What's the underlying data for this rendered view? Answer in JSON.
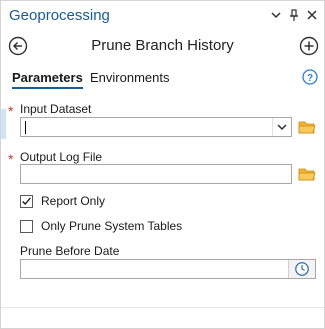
{
  "pane": {
    "title": "Geoprocessing"
  },
  "tool": {
    "title": "Prune Branch History"
  },
  "tabs": [
    {
      "label": "Parameters",
      "active": true
    },
    {
      "label": "Environments",
      "active": false
    }
  ],
  "params": {
    "input_dataset": {
      "label": "Input Dataset",
      "required": true,
      "value": ""
    },
    "output_log": {
      "label": "Output Log File",
      "required": true,
      "value": ""
    },
    "report_only": {
      "label": "Report Only",
      "checked": true
    },
    "system_tables": {
      "label": "Only Prune System Tables",
      "checked": false
    },
    "prune_date": {
      "label": "Prune Before Date",
      "value": ""
    }
  },
  "icons": {
    "options": "chevron-down-icon",
    "pin": "pin-icon",
    "close": "close-icon",
    "back": "back-arrow-icon",
    "add": "add-icon",
    "help": "help-icon",
    "folder": "folder-icon",
    "calendar": "clock-icon"
  },
  "colors": {
    "accent": "#1a5a96",
    "required": "#c23a2b",
    "folder": "#e8a317"
  }
}
